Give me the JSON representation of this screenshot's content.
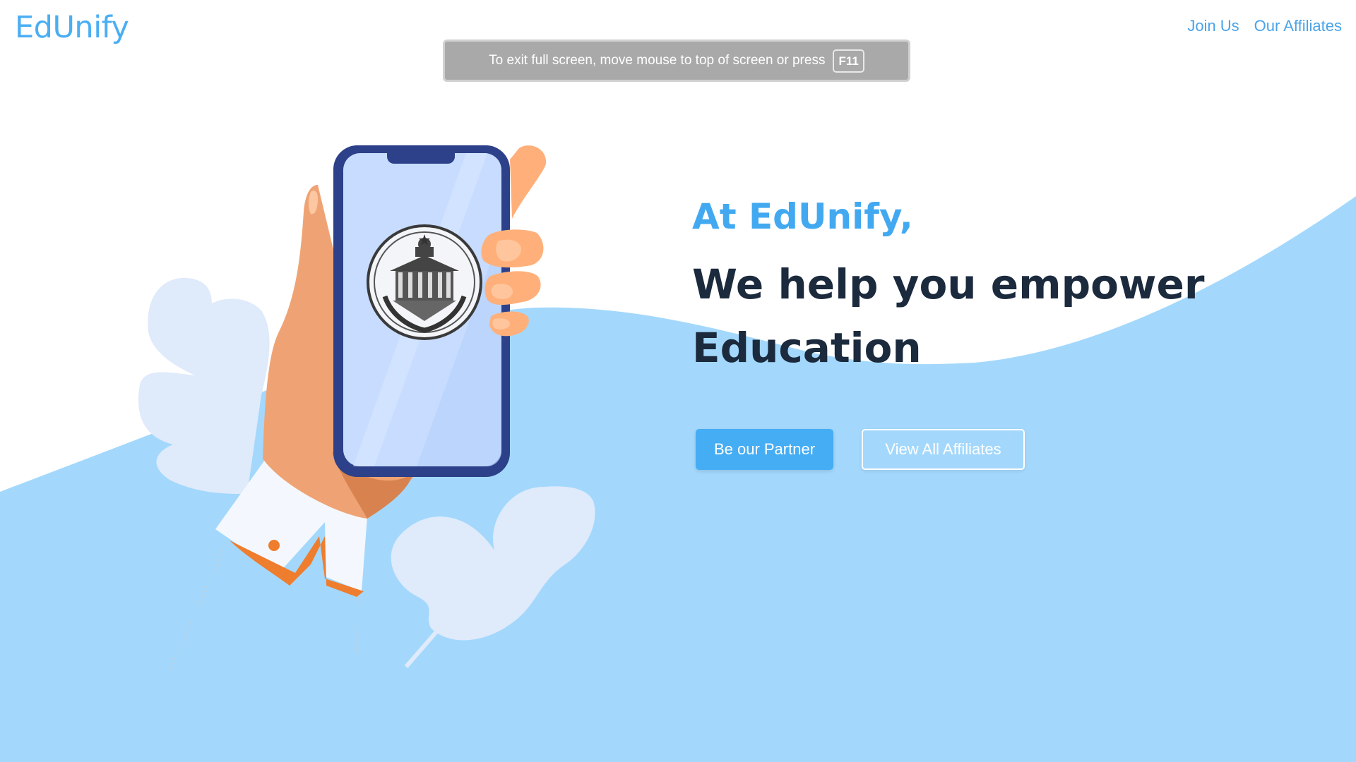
{
  "header": {
    "brand": "EdUnify",
    "nav": [
      "Join Us",
      "Our Affiliates"
    ]
  },
  "fullscreen_banner": {
    "message": "To exit full screen, move mouse to top of screen or press",
    "key": "F11"
  },
  "hero": {
    "lead": "At EdUnify,",
    "title": "We help you empower Education",
    "buttons": {
      "primary": "Be our Partner",
      "secondary": "View All Affiliates"
    }
  },
  "colors": {
    "brand": "#4aaef3",
    "wave": "#a3d8fc",
    "leaf": "#dfeafb",
    "heading": "#1b2a3d",
    "phone_frame": "#2c4189",
    "skin": "#efa374"
  },
  "icons": {
    "emblem": "institution-seal-icon"
  }
}
